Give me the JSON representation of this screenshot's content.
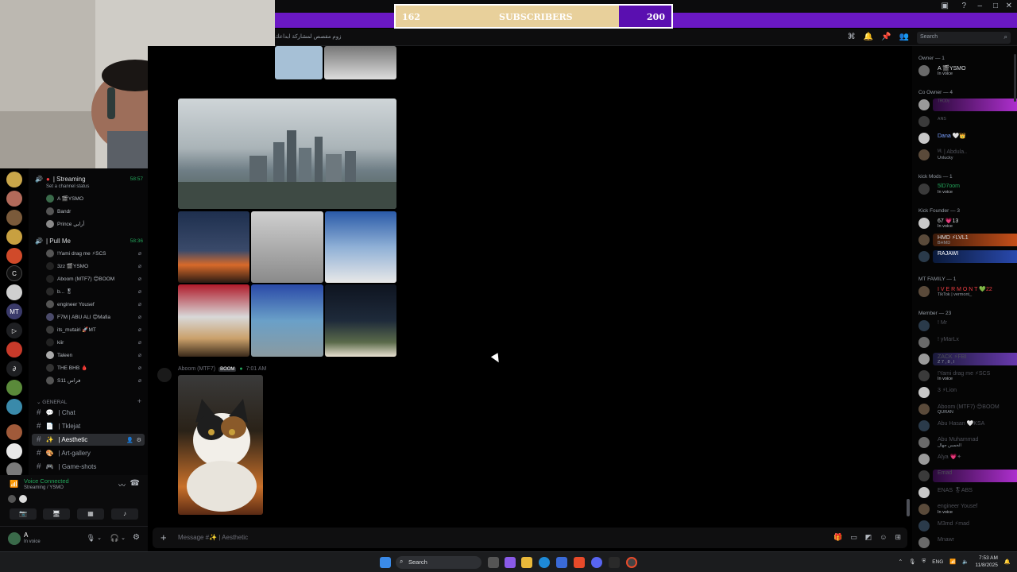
{
  "subscriber_bar": {
    "start": "162",
    "title": "SUBSCRIBERS",
    "end": "200",
    "progress": 0.81
  },
  "header": {
    "topic": "زوم مقصص لمشاركة ابداعك",
    "search_placeholder": "Search"
  },
  "sidebar": {
    "voice_channels": [
      {
        "name": "| Streaming",
        "status": "Set a channel status",
        "time": "58:57",
        "users": [
          "A 🎬YSMO",
          "Bandr",
          "Prince أرابي"
        ]
      },
      {
        "name": "| Pull Me",
        "time": "58:36",
        "users": [
          "!Yami drag me ⚡SCS",
          "3zz 🎬YSMO",
          "Aboom (MTF7) 😊BOOM",
          "b... 🎖",
          "engineer Yousef",
          "F7M | ABU ALI 😊Mafia",
          "its_mutairi 🚀MT",
          "kiir",
          "Taleen",
          "THE BHB 🩸",
          "S11 فراس"
        ]
      }
    ],
    "category": "GENERAL",
    "text_channels": [
      {
        "name": "| Chat",
        "active": false
      },
      {
        "name": "| Tklejat",
        "active": false
      },
      {
        "name": "| Aesthetic",
        "active": true
      },
      {
        "name": "| Art-gallery",
        "active": false
      },
      {
        "name": "| Game-shots",
        "active": false
      }
    ]
  },
  "voice_panel": {
    "status": "Voice Connected",
    "channel": "Streaming / YSMO"
  },
  "user_panel": {
    "name": "A",
    "status": "In voice"
  },
  "chat": {
    "author": "Aboom (MTF7)",
    "badge": "BOOM",
    "time": "7:01 AM",
    "input_placeholder": "Message #✨ | Aesthetic"
  },
  "members": {
    "groups": [
      {
        "name": "Owner — 1",
        "members": [
          {
            "name": "A 🎬YSMO",
            "status": "In voice"
          }
        ]
      },
      {
        "name": "Co Owner — 4",
        "members": [
          {
            "name": "ᵀᴿᴼᴰʸ",
            "status": ""
          },
          {
            "name": "ᴀɴs",
            "status": ""
          },
          {
            "name": "Dana 🤍👑",
            "status": ""
          },
          {
            "name": "ᴹᴸ | Abdula..",
            "status": "Unlucky"
          }
        ]
      },
      {
        "name": "kick Mods — 1",
        "members": [
          {
            "name": "5lD7oom",
            "status": "In voice"
          }
        ]
      },
      {
        "name": "Kick Founder — 3",
        "members": [
          {
            "name": "67 💗13",
            "status": "In voice"
          },
          {
            "name": "HMD ⚡LVL1",
            "status": "BHMD"
          },
          {
            "name": "RAJAWI",
            "status": ""
          }
        ]
      },
      {
        "name": "MT FAMILY — 1",
        "members": [
          {
            "name": "I V E R M O N T 💚22",
            "status": "TikTok | vermont_"
          }
        ]
      },
      {
        "name": "Member — 23",
        "members": [
          {
            "name": "! Mr",
            "status": ""
          },
          {
            "name": "! yMarLx",
            "status": ""
          },
          {
            "name": "ZACK ⚡FBI",
            "status": "Z 7 , 8 , l"
          },
          {
            "name": "!Yami drag me ⚡SCS",
            "status": "In voice"
          },
          {
            "name": "3 ⚡Lion",
            "status": ""
          },
          {
            "name": "Aboom (MTF7) 😊BOOM",
            "status": "QURAN"
          },
          {
            "name": "Abu Hasan 🤍KSA",
            "status": ""
          },
          {
            "name": "Abu Muhammad",
            "status": "الخمس جهال"
          },
          {
            "name": "Alya 💗✦",
            "status": ""
          },
          {
            "name": "Emad",
            "status": ""
          },
          {
            "name": "ENAS 🎖ABS",
            "status": ""
          },
          {
            "name": "engineer Yousef",
            "status": "In voice"
          },
          {
            "name": "M3md ⚡mad",
            "status": ""
          },
          {
            "name": "Mnawr",
            "status": ""
          }
        ]
      }
    ]
  },
  "taskbar": {
    "search": "Search",
    "lang": "ENG",
    "time": "7:53 AM",
    "date": "11/8/2025"
  },
  "colors": {
    "accent_purple": "#6a18c4",
    "bar_gold": "#e8d09b",
    "online_green": "#23a55a"
  }
}
